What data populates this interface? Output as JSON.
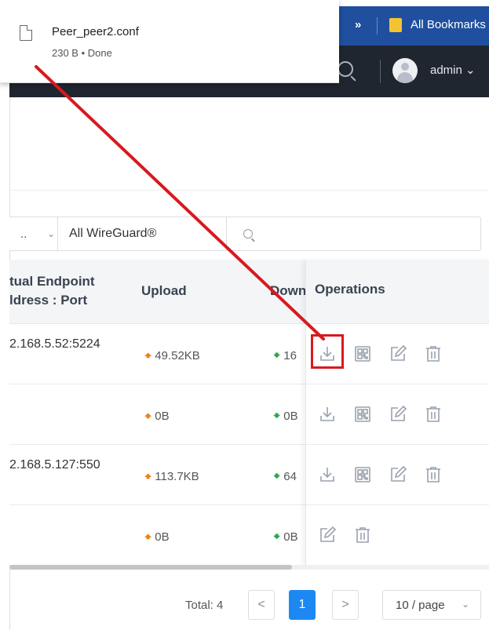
{
  "browser": {
    "bookmarks_chevron": "»",
    "bookmarks_label": "All Bookmarks"
  },
  "download": {
    "file_name": "Peer_peer2.conf",
    "status": "230 B • Done"
  },
  "header": {
    "user": "admin",
    "user_chevron": "⌄"
  },
  "filter": {
    "first_value": "..",
    "first_chevron": "⌄",
    "selected": "All WireGuard®",
    "selected_chevron": "⌄"
  },
  "table": {
    "columns": {
      "endpoint_line1": "tual Endpoint",
      "endpoint_line2": "ldress : Port",
      "upload": "Upload",
      "download": "Download",
      "operations": "Operations"
    },
    "rows": [
      {
        "endpoint": "2.168.5.52:5224",
        "upload": "49.52KB",
        "download": "16",
        "ops": [
          "download-icon",
          "qr-code-icon",
          "edit-icon",
          "delete-icon"
        ]
      },
      {
        "endpoint": "",
        "upload": "0B",
        "download": "0B",
        "ops": [
          "download-icon",
          "qr-code-icon",
          "edit-icon",
          "delete-icon"
        ]
      },
      {
        "endpoint": "2.168.5.127:550",
        "upload": "113.7KB",
        "download": "64",
        "ops": [
          "download-icon",
          "qr-code-icon",
          "edit-icon",
          "delete-icon"
        ]
      },
      {
        "endpoint": "",
        "upload": "0B",
        "download": "0B",
        "ops": [
          "edit-icon",
          "delete-icon"
        ]
      }
    ]
  },
  "pagination": {
    "total": "Total: 4",
    "prev": "<",
    "current": "1",
    "next": ">",
    "page_size": "10 / page",
    "page_size_chevron": "⌄"
  },
  "colors": {
    "header_bg": "#20262f",
    "bookmarks_bg": "#1f4f9e",
    "upload_arrow": "#f07f1b",
    "download_arrow": "#27a84a",
    "highlight": "#d8191f",
    "page_active": "#1e88f2"
  }
}
